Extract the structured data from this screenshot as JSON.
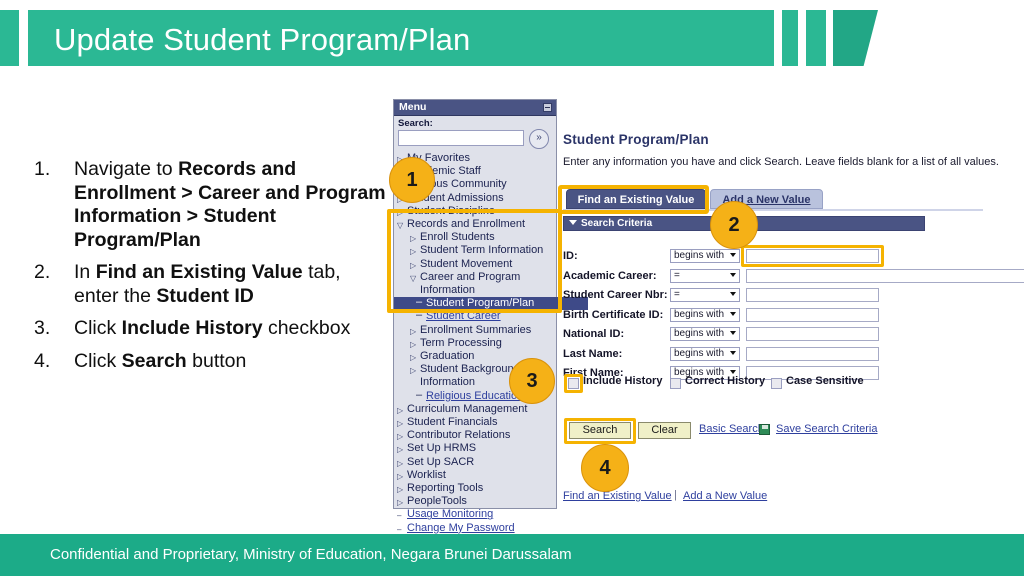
{
  "banner": {
    "title": "Update Student Program/Plan"
  },
  "footer": {
    "text": "Confidential and Proprietary, Ministry of Education, Negara Brunei Darussalam"
  },
  "colors": {
    "brand_green": "#2bb894",
    "footer_green": "#1cab88",
    "highlight_yellow": "#f5b301",
    "badge_yellow": "#f5b117",
    "ps_blue": "#4a5484",
    "link_blue": "#2e3f9e"
  },
  "steps": [
    {
      "num": "1.",
      "parts": [
        {
          "t": "Navigate to ",
          "b": false
        },
        {
          "t": "Records and Enrollment > Career and Program Information > Student Program/Plan",
          "b": true
        }
      ]
    },
    {
      "num": "2.",
      "parts": [
        {
          "t": " In ",
          "b": false
        },
        {
          "t": "Find an Existing Value",
          "b": true
        },
        {
          "t": " tab, enter the ",
          "b": false
        },
        {
          "t": "Student ID",
          "b": true
        }
      ]
    },
    {
      "num": "3.",
      "parts": [
        {
          "t": " Click ",
          "b": false
        },
        {
          "t": "Include History",
          "b": true
        },
        {
          "t": " checkbox",
          "b": false
        }
      ]
    },
    {
      "num": "4.",
      "parts": [
        {
          "t": " Click ",
          "b": false
        },
        {
          "t": "Search",
          "b": true
        },
        {
          "t": " button",
          "b": false
        }
      ]
    }
  ],
  "badges": {
    "one": "1",
    "two": "2",
    "three": "3",
    "four": "4"
  },
  "menu": {
    "title": "Menu",
    "search_label": "Search:",
    "search_value": "",
    "search_go": "»",
    "items": [
      {
        "label": "My Favorites",
        "level": 1,
        "arrow": "▷",
        "link": false,
        "selected": false
      },
      {
        "label": "Academic Staff",
        "level": 1,
        "arrow": "▷",
        "link": false,
        "selected": false
      },
      {
        "label": "Campus Community",
        "level": 1,
        "arrow": "▷",
        "link": false,
        "selected": false
      },
      {
        "label": "Student Admissions",
        "level": 1,
        "arrow": "▷",
        "link": false,
        "selected": false
      },
      {
        "label": "Student Discipline",
        "level": 1,
        "arrow": "▷",
        "link": false,
        "selected": false
      },
      {
        "label": "Records and Enrollment",
        "level": 1,
        "arrow": "▽",
        "link": false,
        "selected": false
      },
      {
        "label": "Enroll Students",
        "level": 2,
        "arrow": "▷",
        "link": false,
        "selected": false
      },
      {
        "label": "Student Term Information",
        "level": 2,
        "arrow": "▷",
        "link": false,
        "selected": false
      },
      {
        "label": "Student Movement",
        "level": 2,
        "arrow": "▷",
        "link": false,
        "selected": false
      },
      {
        "label": "Career and Program Information",
        "level": 2,
        "arrow": "▽",
        "link": false,
        "selected": false,
        "wrap": true
      },
      {
        "label": "Student Program/Plan",
        "level": 3,
        "arrow": "–",
        "link": false,
        "selected": true
      },
      {
        "label": "Student Career",
        "level": 3,
        "arrow": "–",
        "link": true,
        "selected": false
      },
      {
        "label": "Enrollment Summaries",
        "level": 2,
        "arrow": "▷",
        "link": false,
        "selected": false
      },
      {
        "label": "Term Processing",
        "level": 2,
        "arrow": "▷",
        "link": false,
        "selected": false
      },
      {
        "label": "Graduation",
        "level": 2,
        "arrow": "▷",
        "link": false,
        "selected": false
      },
      {
        "label": "Student Background Information",
        "level": 2,
        "arrow": "▷",
        "link": false,
        "selected": false,
        "wrap": true
      },
      {
        "label": "Religious Education",
        "level": 3,
        "arrow": "–",
        "link": true,
        "selected": false
      },
      {
        "label": "Curriculum Management",
        "level": 1,
        "arrow": "▷",
        "link": false,
        "selected": false
      },
      {
        "label": "Student Financials",
        "level": 1,
        "arrow": "▷",
        "link": false,
        "selected": false
      },
      {
        "label": "Contributor Relations",
        "level": 1,
        "arrow": "▷",
        "link": false,
        "selected": false
      },
      {
        "label": "Set Up HRMS",
        "level": 1,
        "arrow": "▷",
        "link": false,
        "selected": false
      },
      {
        "label": "Set Up SACR",
        "level": 1,
        "arrow": "▷",
        "link": false,
        "selected": false
      },
      {
        "label": "Worklist",
        "level": 1,
        "arrow": "▷",
        "link": false,
        "selected": false
      },
      {
        "label": "Reporting Tools",
        "level": 1,
        "arrow": "▷",
        "link": false,
        "selected": false
      },
      {
        "label": "PeopleTools",
        "level": 1,
        "arrow": "▷",
        "link": false,
        "selected": false
      },
      {
        "label": "Usage Monitoring",
        "level": 1,
        "arrow": "–",
        "link": true,
        "selected": false
      },
      {
        "label": "Change My Password",
        "level": 1,
        "arrow": "–",
        "link": true,
        "selected": false
      }
    ]
  },
  "page": {
    "title": "Student Program/Plan",
    "instruction": "Enter any information you have and click Search. Leave fields blank for a list of all values.",
    "tabs": [
      {
        "label": "Find an Existing Value",
        "active": true
      },
      {
        "label": "Add a New Value",
        "active": false
      }
    ],
    "criteria_header": "Search Criteria",
    "fields": [
      {
        "label": "ID:",
        "operator": "begins with",
        "value": "",
        "value_type": "text",
        "highlighted": true
      },
      {
        "label": "Academic Career:",
        "operator": "=",
        "value": "",
        "value_type": "select",
        "highlighted": false
      },
      {
        "label": "Student Career Nbr:",
        "operator": "=",
        "value": "",
        "value_type": "text",
        "highlighted": false
      },
      {
        "label": "Birth Certificate ID:",
        "operator": "begins with",
        "value": "",
        "value_type": "text",
        "highlighted": false
      },
      {
        "label": "National ID:",
        "operator": "begins with",
        "value": "",
        "value_type": "text",
        "highlighted": false
      },
      {
        "label": "Last Name:",
        "operator": "begins with",
        "value": "",
        "value_type": "text",
        "highlighted": false
      },
      {
        "label": "First Name:",
        "operator": "begins with",
        "value": "",
        "value_type": "text",
        "highlighted": false
      }
    ],
    "checkboxes": [
      {
        "label": "Include History",
        "checked": false,
        "highlighted": true
      },
      {
        "label": "Correct History",
        "checked": false,
        "highlighted": false
      },
      {
        "label": "Case Sensitive",
        "checked": false,
        "highlighted": false
      }
    ],
    "buttons": [
      {
        "label": "Search",
        "highlighted": true
      },
      {
        "label": "Clear",
        "highlighted": false
      }
    ],
    "links": {
      "basic_search": "Basic Search",
      "save_search_criteria": "Save Search Criteria",
      "bottom_find": "Find an Existing Value",
      "bottom_separator": "|",
      "bottom_add": "Add a New Value"
    }
  }
}
